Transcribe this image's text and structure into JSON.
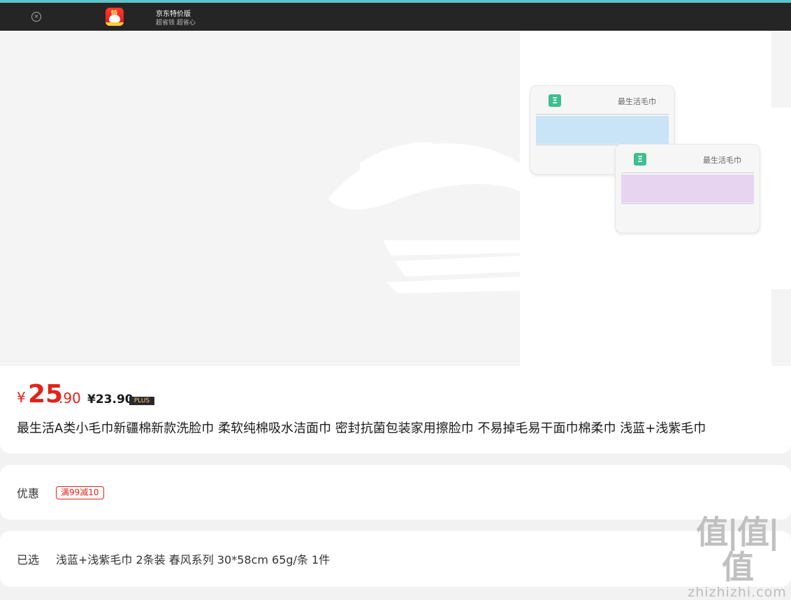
{
  "app_bar": {
    "close_icon": "×",
    "app_name": "京东特价版",
    "slogan": "超省钱 超省心",
    "logo_badge": "特"
  },
  "product_image": {
    "towels": [
      {
        "brand": "最生活毛巾",
        "logo": "Ξ",
        "band_color": "#c9e4f6"
      },
      {
        "brand": "最生活毛巾",
        "logo": "Ξ",
        "band_color": "#e6d4f0"
      }
    ]
  },
  "price": {
    "currency": "¥",
    "integer": "25",
    "decimal": ".90",
    "plus_price": "¥23.90",
    "plus_badge": "PLUS"
  },
  "product_title": "最生活A类小毛巾新疆棉新款洗脸巾 柔软纯棉吸水洁面巾 密封抗菌包装家用擦脸巾 不易掉毛易干面巾棉柔巾 浅蓝+浅紫毛巾",
  "coupon": {
    "label": "优惠",
    "tag": "满99减10"
  },
  "selection": {
    "label": "已选",
    "value": "浅蓝+浅紫毛巾 2条装 春风系列 30*58cm 65g/条 1件"
  },
  "watermark": {
    "main": "值|值|值",
    "site": "zhizhizhi.com"
  },
  "colors": {
    "accent_red": "#e2231a",
    "appbar_bg": "#252526",
    "top_line": "#5bc4c9"
  }
}
